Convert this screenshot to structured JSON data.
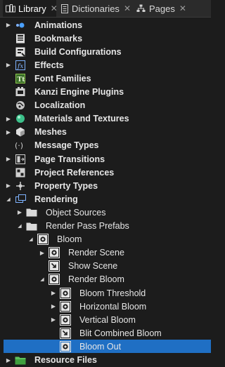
{
  "tabs": [
    {
      "label": "Library",
      "icon": "library-icon",
      "active": true
    },
    {
      "label": "Dictionaries",
      "icon": "dictionaries-icon",
      "active": false
    },
    {
      "label": "Pages",
      "icon": "pages-icon",
      "active": false
    }
  ],
  "tree": [
    {
      "label": "Animations",
      "arrow": "right",
      "icon": "animations-icon",
      "depth": 0
    },
    {
      "label": "Bookmarks",
      "arrow": "",
      "icon": "bookmarks-icon",
      "depth": 0
    },
    {
      "label": "Build Configurations",
      "arrow": "",
      "icon": "build-configurations-icon",
      "depth": 0
    },
    {
      "label": "Effects",
      "arrow": "right",
      "icon": "effects-icon",
      "depth": 0
    },
    {
      "label": "Font Families",
      "arrow": "",
      "icon": "font-families-icon",
      "depth": 0
    },
    {
      "label": "Kanzi Engine Plugins",
      "arrow": "",
      "icon": "plugins-icon",
      "depth": 0
    },
    {
      "label": "Localization",
      "arrow": "",
      "icon": "localization-icon",
      "depth": 0
    },
    {
      "label": "Materials and Textures",
      "arrow": "right",
      "icon": "materials-icon",
      "depth": 0
    },
    {
      "label": "Meshes",
      "arrow": "right",
      "icon": "meshes-icon",
      "depth": 0
    },
    {
      "label": "Message Types",
      "arrow": "",
      "icon": "message-types-icon",
      "depth": 0
    },
    {
      "label": "Page Transitions",
      "arrow": "right",
      "icon": "page-transitions-icon",
      "depth": 0
    },
    {
      "label": "Project References",
      "arrow": "",
      "icon": "project-references-icon",
      "depth": 0
    },
    {
      "label": "Property Types",
      "arrow": "right",
      "icon": "property-types-icon",
      "depth": 0
    },
    {
      "label": "Rendering",
      "arrow": "down",
      "icon": "rendering-icon",
      "depth": 0
    },
    {
      "label": "Object Sources",
      "arrow": "right",
      "icon": "folder-icon",
      "depth": 1
    },
    {
      "label": "Render Pass Prefabs",
      "arrow": "down",
      "icon": "folder-icon",
      "depth": 1
    },
    {
      "label": "Bloom",
      "arrow": "down",
      "icon": "render-pass-icon",
      "depth": 2
    },
    {
      "label": "Render Scene",
      "arrow": "right",
      "icon": "render-pass-icon",
      "depth": 3
    },
    {
      "label": "Show Scene",
      "arrow": "",
      "icon": "blit-pass-icon",
      "depth": 3
    },
    {
      "label": "Render Bloom",
      "arrow": "down",
      "icon": "render-pass-icon",
      "depth": 3
    },
    {
      "label": "Bloom Threshold",
      "arrow": "right",
      "icon": "render-pass-icon",
      "depth": 4
    },
    {
      "label": "Horizontal Bloom",
      "arrow": "right",
      "icon": "render-pass-icon",
      "depth": 4
    },
    {
      "label": "Vertical Bloom",
      "arrow": "right",
      "icon": "render-pass-icon",
      "depth": 4
    },
    {
      "label": "Blit Combined Bloom",
      "arrow": "",
      "icon": "blit-pass-icon",
      "depth": 4
    },
    {
      "label": "Bloom Out",
      "arrow": "",
      "icon": "render-pass-icon",
      "depth": 4,
      "selected": true
    },
    {
      "label": "Resource Files",
      "arrow": "right",
      "icon": "resource-files-icon",
      "depth": 0
    }
  ],
  "colors": {
    "selection": "#1f6fc4",
    "background": "#1c1c1c",
    "tabbar": "#2b2b2b",
    "folder": "#d9d9d9",
    "accent_blue": "#4aa0ff",
    "accent_green": "#3cc08a"
  }
}
